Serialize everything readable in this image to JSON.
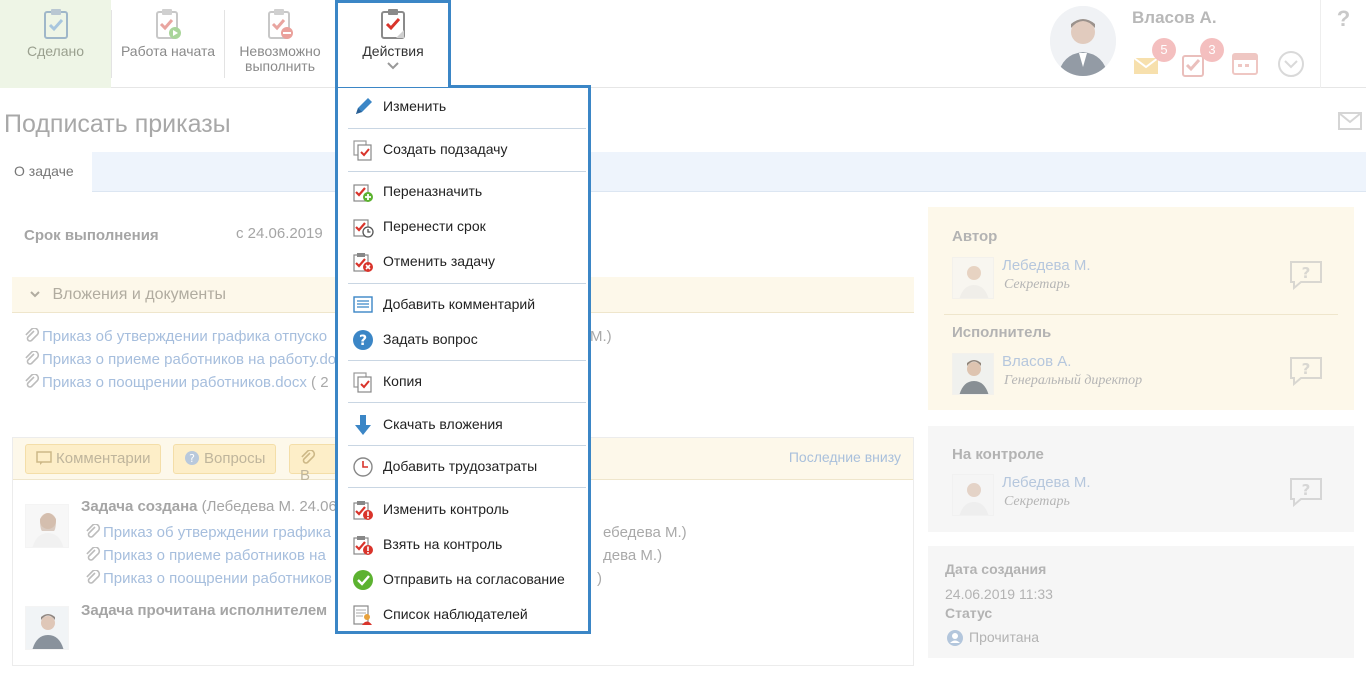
{
  "toolbar": {
    "done_label": "Сделано",
    "work_started_label": "Работа начата",
    "impossible_label_1": "Невозможно",
    "impossible_label_2": "выполнить",
    "actions_label": "Действия"
  },
  "user": {
    "name": "Власов А.",
    "mail_count": "5",
    "tasks_count": "3"
  },
  "help_label": "?",
  "page": {
    "title": "Подписать приказы",
    "tab_about": "О задаче"
  },
  "task": {
    "deadline_label": "Срок выполнения",
    "deadline_value": "с 24.06.2019",
    "attachments_header": "Вложения и документы",
    "attachments": [
      {
        "name": "Приказ об утверждении графика отпуско",
        "tail": "",
        "tail2": "М.)"
      },
      {
        "name": "Приказ о приеме работников на работу.do",
        "tail": "",
        "tail2": ""
      },
      {
        "name": "Приказ о поощрении работников.docx",
        "tail": " ( 2",
        "tail2": ""
      }
    ]
  },
  "feed": {
    "tab_comments": "Комментарии",
    "tab_questions": "Вопросы",
    "tab_third": "В",
    "last_below": "Последние внизу",
    "event1_title": "Задача создана",
    "event1_meta": " (Лебедева М. 24.06",
    "event1_files": [
      {
        "name": "Приказ об утверждении графика",
        "tail": "ебедева М.)"
      },
      {
        "name": "Приказ о приеме работников на",
        "tail": "дева М.)"
      },
      {
        "name": "Приказ о поощрении работников",
        "tail": ")"
      }
    ],
    "event2_title": "Задача прочитана исполнителем"
  },
  "sidebar": {
    "author_label": "Автор",
    "author_name": "Лебедева М.",
    "author_role": "Секретарь",
    "executor_label": "Исполнитель",
    "executor_name": "Власов А.",
    "executor_role": "Генеральный директор",
    "control_label": "На контроле",
    "control_name": "Лебедева М.",
    "control_role": "Секретарь",
    "created_label": "Дата создания",
    "created_value": "24.06.2019 11:33",
    "status_label": "Статус",
    "status_value": "Прочитана"
  },
  "menu": {
    "items": [
      {
        "label": "Изменить",
        "icon": "pencil-icon"
      },
      {
        "label": "Создать подзадачу",
        "icon": "subtask-icon"
      },
      {
        "label": "Переназначить",
        "icon": "reassign-icon"
      },
      {
        "label": "Перенести срок",
        "icon": "reschedule-icon"
      },
      {
        "label": "Отменить задачу",
        "icon": "cancel-task-icon"
      },
      {
        "label": "Добавить комментарий",
        "icon": "comment-icon"
      },
      {
        "label": "Задать вопрос",
        "icon": "question-icon"
      },
      {
        "label": "Копия",
        "icon": "copy-icon"
      },
      {
        "label": "Скачать вложения",
        "icon": "download-icon"
      },
      {
        "label": "Добавить трудозатраты",
        "icon": "clock-icon"
      },
      {
        "label": "Изменить контроль",
        "icon": "change-control-icon"
      },
      {
        "label": "Взять на контроль",
        "icon": "take-control-icon"
      },
      {
        "label": "Отправить на согласование",
        "icon": "approve-icon"
      },
      {
        "label": "Список наблюдателей",
        "icon": "observers-icon"
      }
    ]
  },
  "colors": {
    "accent": "#3b86c6",
    "red": "#d9342b",
    "green": "#5cb230"
  }
}
